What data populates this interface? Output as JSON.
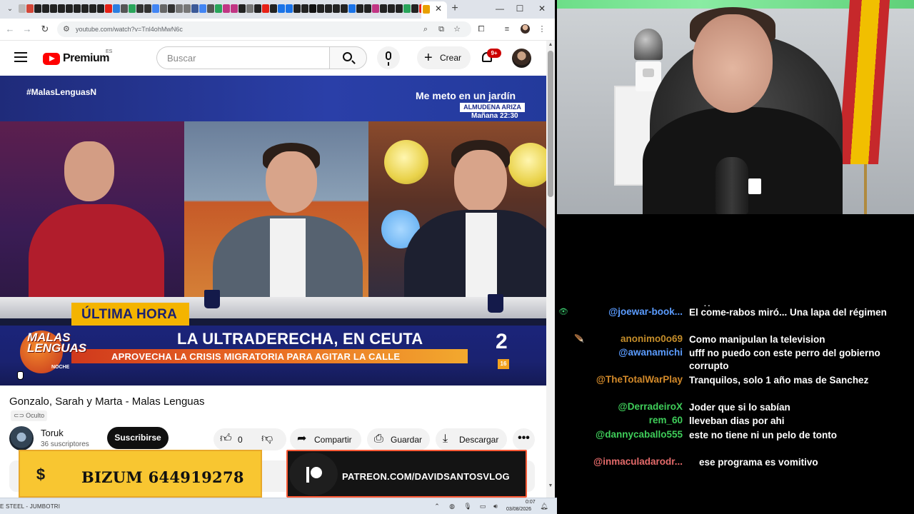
{
  "browser": {
    "url": "youtube.com/watch?v=Tnl4ohMwN6c",
    "tabs_dropdown": "⌄",
    "new_tab": "+",
    "close_tab": "✕",
    "minimize": "—",
    "maximize": "☐",
    "close_window": "✕"
  },
  "youtube": {
    "logo_word": "Premium",
    "region": "ES",
    "search_placeholder": "Buscar",
    "create_label": "Crear",
    "notif_count": "9+"
  },
  "video_frame": {
    "hashtag": "#MalasLenguasN",
    "promo_title": "Me meto en un jardín",
    "promo_name": "ALMUDENA ARIZA",
    "promo_time": "Mañana 22:30",
    "ultima_hora": "ÚLTIMA HORA",
    "headline": "LA ULTRADERECHA, EN CEUTA",
    "subheadline": "APROVECHA LA CRISIS MIGRATORIA PARA AGITAR LA CALLE",
    "show_logo": "MALAS LENGUAS",
    "show_logo_sub": "NOCHE",
    "channel_number": "2",
    "age_rating": "16"
  },
  "video_info": {
    "title": "Gonzalo, Sarah y Marta - Malas Lenguas",
    "visibility": "Oculto",
    "channel_name": "Toruk",
    "subscribers": "36 suscriptores",
    "subscribe_label": "Suscribirse",
    "like_count": "0",
    "share_label": "Compartir",
    "save_label": "Guardar",
    "download_label": "Descargar",
    "more": "•••"
  },
  "overlays": {
    "bizum_text": "BIZUM 644919278",
    "bizum_icon": "$",
    "patreon_text": "PATREON.COM/DAVIDSANTOSVLOG"
  },
  "taskbar": {
    "now_playing": "E STEEL - JUMBOTRI",
    "time": "0:07",
    "date": "03/08/2026"
  },
  "chat": {
    "cut_off": ". .",
    "messages": [
      {
        "user": "@joewar-book...",
        "color": "#5b9cff",
        "badge": "👁",
        "badge_color": "#39c46b",
        "text": "El come-rabos miró... Una lapa del régimen"
      },
      {
        "user": "anonimo0o69",
        "color": "#c48d2a",
        "badge": "🪶",
        "badge_color": "#e8d9a0",
        "text": "Como manipulan la television"
      },
      {
        "user": "@awanamichi",
        "color": "#5b9cff",
        "badge": "",
        "badge_color": "",
        "text": "ufff no puedo con este perro del gobierno corrupto"
      },
      {
        "user": "@TheTotalWarPlay",
        "color": "#d38a2a",
        "badge": "",
        "badge_color": "",
        "text": "Tranquilos, solo 1 año mas de Sanchez"
      },
      {
        "user": "@DerradeiroX",
        "color": "#3fce5a",
        "badge": "",
        "badge_color": "",
        "text": "Joder que si lo sabían"
      },
      {
        "user": "rem_60",
        "color": "#3fce5a",
        "badge": "",
        "badge_color": "",
        "text": "lleveban dias por ahi"
      },
      {
        "user": "@dannycaballo555",
        "color": "#3fce5a",
        "badge": "",
        "badge_color": "",
        "text": "este no tiene ni un pelo de tonto"
      },
      {
        "user": "@inmaculadarodr...",
        "color": "#e46a6a",
        "badge": "",
        "badge_color": "",
        "text": "ese programa es vomitivo"
      }
    ]
  },
  "colors": {
    "youtube_red": "#ff0000",
    "bizum_yellow": "#f8c631",
    "patreon_orange": "#ff5a36",
    "news_blue": "#1b247a",
    "ultima_yellow": "#f4b400"
  }
}
